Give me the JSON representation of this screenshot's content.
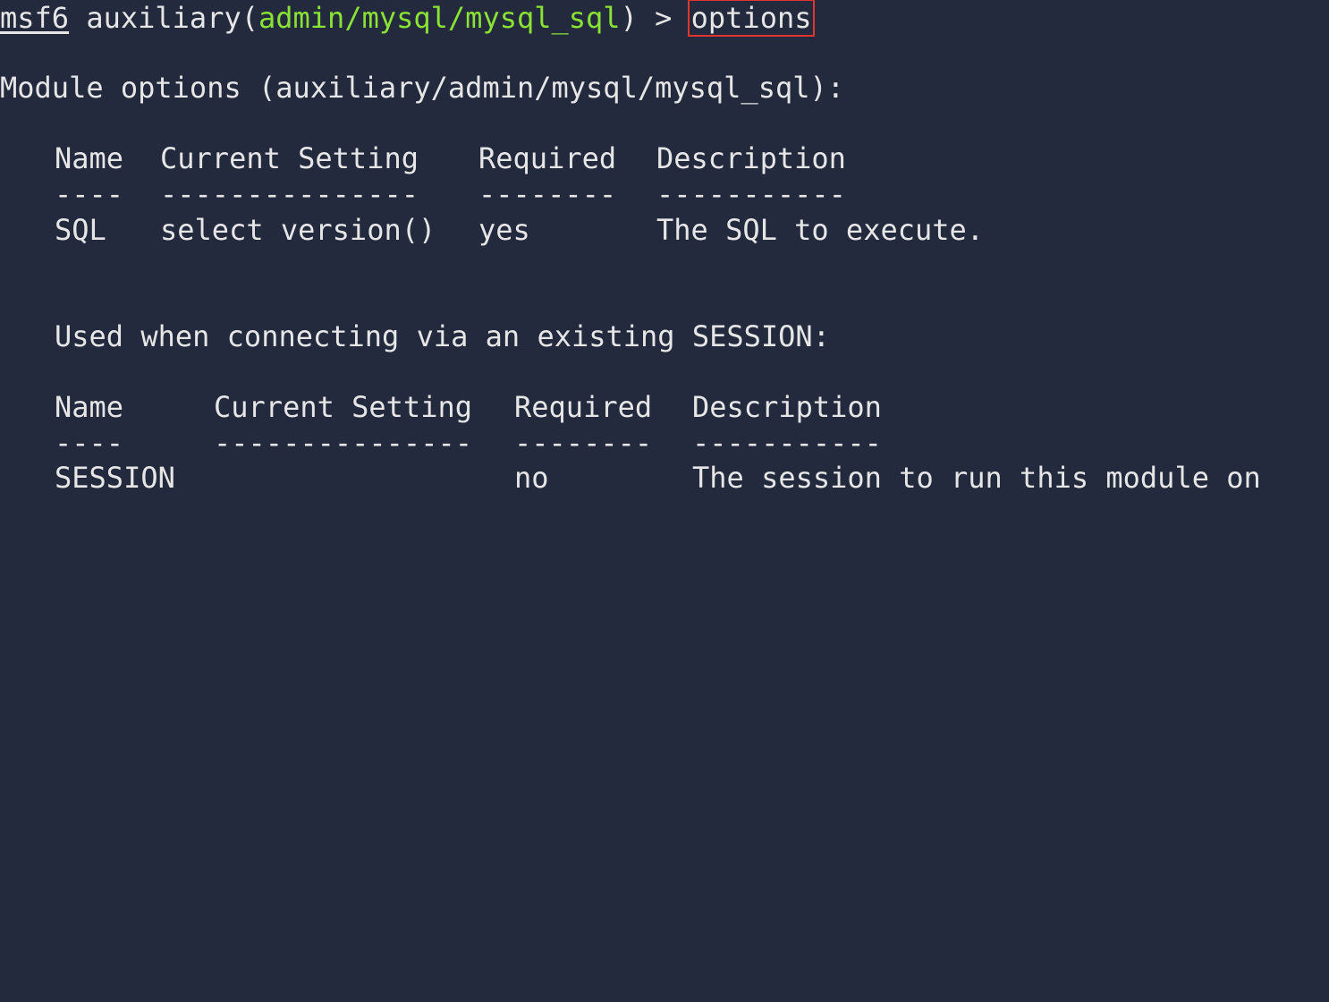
{
  "prompt": {
    "name": "msf6",
    "module_prefix": " auxiliary(",
    "module_path": "admin/mysql/mysql_sql",
    "module_suffix": ") > ",
    "command": "options"
  },
  "colors": {
    "background": "#232a3d",
    "text": "#e6e6e6",
    "module_path": "#8ae234",
    "highlight_box": "#e0362c"
  },
  "module_options": {
    "title": "Module options (auxiliary/admin/mysql/mysql_sql):",
    "headers": [
      "Name",
      "Current Setting",
      "Required",
      "Description"
    ],
    "separators": [
      "----",
      "---------------",
      "--------",
      "-----------"
    ],
    "rows": [
      [
        "SQL",
        "select version()",
        "yes",
        "The SQL to execute."
      ]
    ]
  },
  "session_options": {
    "title": "Used when connecting via an existing SESSION:",
    "headers": [
      "Name",
      "Current Setting",
      "Required",
      "Description"
    ],
    "separators": [
      "----",
      "---------------",
      "--------",
      "-----------"
    ],
    "rows": [
      [
        "SESSION",
        "",
        "no",
        "The session to run this module on"
      ]
    ]
  }
}
